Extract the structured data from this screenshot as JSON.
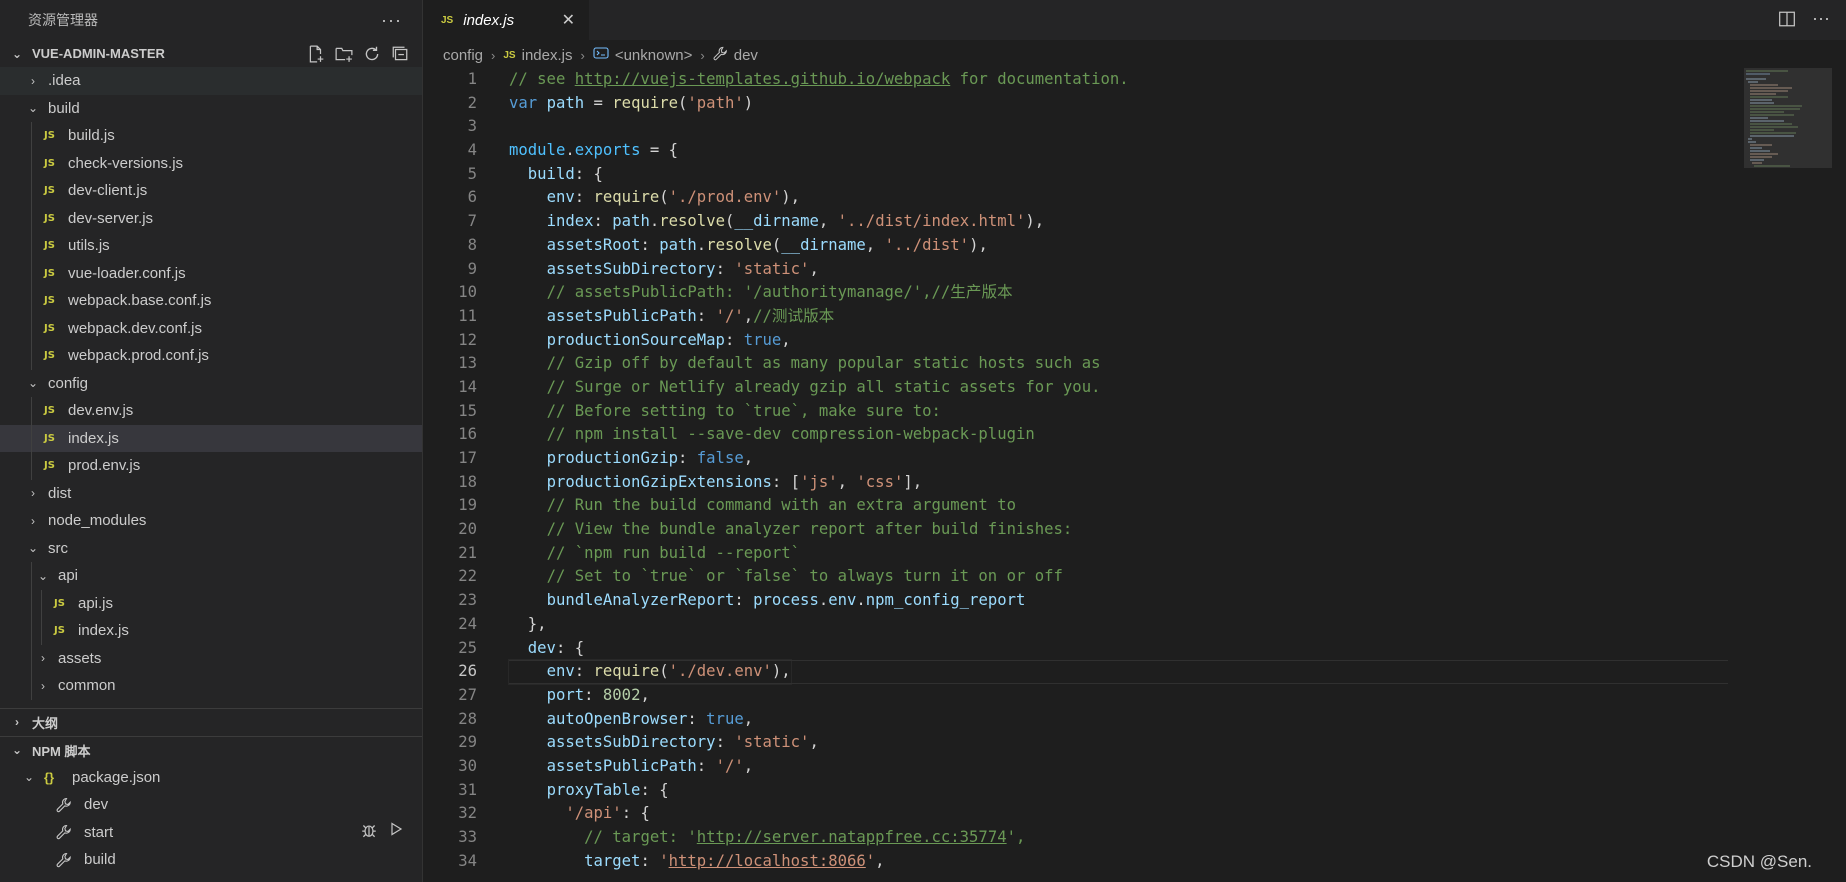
{
  "explorer": {
    "title": "资源管理器",
    "more": "···",
    "project": "VUE-ADMIN-MASTER",
    "tree": [
      {
        "label": ".idea",
        "type": "folder",
        "open": false,
        "depth": 0
      },
      {
        "label": "build",
        "type": "folder",
        "open": true,
        "depth": 0
      },
      {
        "label": "build.js",
        "type": "js",
        "depth": 1
      },
      {
        "label": "check-versions.js",
        "type": "js",
        "depth": 1
      },
      {
        "label": "dev-client.js",
        "type": "js",
        "depth": 1
      },
      {
        "label": "dev-server.js",
        "type": "js",
        "depth": 1
      },
      {
        "label": "utils.js",
        "type": "js",
        "depth": 1
      },
      {
        "label": "vue-loader.conf.js",
        "type": "js",
        "depth": 1
      },
      {
        "label": "webpack.base.conf.js",
        "type": "js",
        "depth": 1
      },
      {
        "label": "webpack.dev.conf.js",
        "type": "js",
        "depth": 1
      },
      {
        "label": "webpack.prod.conf.js",
        "type": "js",
        "depth": 1
      },
      {
        "label": "config",
        "type": "folder",
        "open": true,
        "depth": 0
      },
      {
        "label": "dev.env.js",
        "type": "js",
        "depth": 1
      },
      {
        "label": "index.js",
        "type": "js",
        "depth": 1,
        "selected": true
      },
      {
        "label": "prod.env.js",
        "type": "js",
        "depth": 1
      },
      {
        "label": "dist",
        "type": "folder",
        "open": false,
        "depth": 0
      },
      {
        "label": "node_modules",
        "type": "folder",
        "open": false,
        "depth": 0
      },
      {
        "label": "src",
        "type": "folder",
        "open": true,
        "depth": 0
      },
      {
        "label": "api",
        "type": "folder",
        "open": true,
        "depth": 1
      },
      {
        "label": "api.js",
        "type": "js",
        "depth": 2
      },
      {
        "label": "index.js",
        "type": "js",
        "depth": 2
      },
      {
        "label": "assets",
        "type": "folder",
        "open": false,
        "depth": 1
      },
      {
        "label": "common",
        "type": "folder",
        "open": false,
        "depth": 1
      }
    ],
    "outline_label": "大纲",
    "npm_label": "NPM 脚本",
    "npm": {
      "package": "package.json",
      "scripts": [
        "dev",
        "start",
        "build"
      ]
    }
  },
  "tab": {
    "label": "index.js",
    "close": "✕"
  },
  "breadcrumb": {
    "folder": "config",
    "file": "index.js",
    "symbol": "<unknown>",
    "member": "dev"
  },
  "watermark": "CSDN @Sen.",
  "colors": {
    "accent": "#007acc",
    "comment": "#6a9955",
    "string": "#ce9178",
    "keyword": "#569cd6",
    "property": "#9cdcfe",
    "function": "#dcdcaa",
    "js_icon": "#cbcb41"
  },
  "code": [
    {
      "n": "1",
      "tokens": [
        [
          "c",
          "// see "
        ],
        [
          "cu",
          "http://vuejs-templates.github.io/webpack"
        ],
        [
          "c",
          " for documentation."
        ]
      ]
    },
    {
      "n": "2",
      "tokens": [
        [
          "k",
          "var "
        ],
        [
          "p",
          "path"
        ],
        [
          "o",
          " = "
        ],
        [
          "f",
          "require"
        ],
        [
          "o",
          "("
        ],
        [
          "s",
          "'path'"
        ],
        [
          "o",
          ")"
        ]
      ]
    },
    {
      "n": "3",
      "tokens": []
    },
    {
      "n": "4",
      "tokens": [
        [
          "v",
          "module"
        ],
        [
          "o",
          "."
        ],
        [
          "v",
          "exports"
        ],
        [
          "o",
          " = {"
        ]
      ]
    },
    {
      "n": "5",
      "tokens": [
        [
          "o",
          "  "
        ],
        [
          "p",
          "build"
        ],
        [
          "o",
          ": {"
        ]
      ]
    },
    {
      "n": "6",
      "tokens": [
        [
          "o",
          "    "
        ],
        [
          "p",
          "env"
        ],
        [
          "o",
          ": "
        ],
        [
          "f",
          "require"
        ],
        [
          "o",
          "("
        ],
        [
          "s",
          "'./prod.env'"
        ],
        [
          "o",
          "),"
        ]
      ]
    },
    {
      "n": "7",
      "tokens": [
        [
          "o",
          "    "
        ],
        [
          "p",
          "index"
        ],
        [
          "o",
          ": "
        ],
        [
          "p",
          "path"
        ],
        [
          "o",
          "."
        ],
        [
          "f",
          "resolve"
        ],
        [
          "o",
          "("
        ],
        [
          "p",
          "__dirname"
        ],
        [
          "o",
          ", "
        ],
        [
          "s",
          "'../dist/index.html'"
        ],
        [
          "o",
          "),"
        ]
      ]
    },
    {
      "n": "8",
      "tokens": [
        [
          "o",
          "    "
        ],
        [
          "p",
          "assetsRoot"
        ],
        [
          "o",
          ": "
        ],
        [
          "p",
          "path"
        ],
        [
          "o",
          "."
        ],
        [
          "f",
          "resolve"
        ],
        [
          "o",
          "("
        ],
        [
          "p",
          "__dirname"
        ],
        [
          "o",
          ", "
        ],
        [
          "s",
          "'../dist'"
        ],
        [
          "o",
          "),"
        ]
      ]
    },
    {
      "n": "9",
      "tokens": [
        [
          "o",
          "    "
        ],
        [
          "p",
          "assetsSubDirectory"
        ],
        [
          "o",
          ": "
        ],
        [
          "s",
          "'static'"
        ],
        [
          "o",
          ","
        ]
      ]
    },
    {
      "n": "10",
      "tokens": [
        [
          "o",
          "    "
        ],
        [
          "c",
          "// assetsPublicPath: '/authoritymanage/',//生产版本"
        ]
      ]
    },
    {
      "n": "11",
      "tokens": [
        [
          "o",
          "    "
        ],
        [
          "p",
          "assetsPublicPath"
        ],
        [
          "o",
          ": "
        ],
        [
          "s",
          "'/'"
        ],
        [
          "o",
          ","
        ],
        [
          "c",
          "//测试版本"
        ]
      ]
    },
    {
      "n": "12",
      "tokens": [
        [
          "o",
          "    "
        ],
        [
          "p",
          "productionSourceMap"
        ],
        [
          "o",
          ": "
        ],
        [
          "k",
          "true"
        ],
        [
          "o",
          ","
        ]
      ]
    },
    {
      "n": "13",
      "tokens": [
        [
          "o",
          "    "
        ],
        [
          "c",
          "// Gzip off by default as many popular static hosts such as"
        ]
      ]
    },
    {
      "n": "14",
      "tokens": [
        [
          "o",
          "    "
        ],
        [
          "c",
          "// Surge or Netlify already gzip all static assets for you."
        ]
      ]
    },
    {
      "n": "15",
      "tokens": [
        [
          "o",
          "    "
        ],
        [
          "c",
          "// Before setting to `true`, make sure to:"
        ]
      ]
    },
    {
      "n": "16",
      "tokens": [
        [
          "o",
          "    "
        ],
        [
          "c",
          "// npm install --save-dev compression-webpack-plugin"
        ]
      ]
    },
    {
      "n": "17",
      "tokens": [
        [
          "o",
          "    "
        ],
        [
          "p",
          "productionGzip"
        ],
        [
          "o",
          ": "
        ],
        [
          "k",
          "false"
        ],
        [
          "o",
          ","
        ]
      ]
    },
    {
      "n": "18",
      "tokens": [
        [
          "o",
          "    "
        ],
        [
          "p",
          "productionGzipExtensions"
        ],
        [
          "o",
          ": ["
        ],
        [
          "s",
          "'js'"
        ],
        [
          "o",
          ", "
        ],
        [
          "s",
          "'css'"
        ],
        [
          "o",
          "],"
        ]
      ]
    },
    {
      "n": "19",
      "tokens": [
        [
          "o",
          "    "
        ],
        [
          "c",
          "// Run the build command with an extra argument to"
        ]
      ]
    },
    {
      "n": "20",
      "tokens": [
        [
          "o",
          "    "
        ],
        [
          "c",
          "// View the bundle analyzer report after build finishes:"
        ]
      ]
    },
    {
      "n": "21",
      "tokens": [
        [
          "o",
          "    "
        ],
        [
          "c",
          "// `npm run build --report`"
        ]
      ]
    },
    {
      "n": "22",
      "tokens": [
        [
          "o",
          "    "
        ],
        [
          "c",
          "// Set to `true` or `false` to always turn it on or off"
        ]
      ]
    },
    {
      "n": "23",
      "tokens": [
        [
          "o",
          "    "
        ],
        [
          "p",
          "bundleAnalyzerReport"
        ],
        [
          "o",
          ": "
        ],
        [
          "p",
          "process"
        ],
        [
          "o",
          "."
        ],
        [
          "p",
          "env"
        ],
        [
          "o",
          "."
        ],
        [
          "p",
          "npm_config_report"
        ]
      ]
    },
    {
      "n": "24",
      "tokens": [
        [
          "o",
          "  },"
        ]
      ]
    },
    {
      "n": "25",
      "tokens": [
        [
          "o",
          "  "
        ],
        [
          "p",
          "dev"
        ],
        [
          "o",
          ": {"
        ]
      ]
    },
    {
      "n": "26",
      "tokens": [
        [
          "o",
          "    "
        ],
        [
          "p",
          "env"
        ],
        [
          "o",
          ": "
        ],
        [
          "f",
          "require"
        ],
        [
          "o",
          "("
        ],
        [
          "s",
          "'./dev.env'"
        ],
        [
          "o",
          "),"
        ]
      ],
      "active": true
    },
    {
      "n": "27",
      "tokens": [
        [
          "o",
          "    "
        ],
        [
          "p",
          "port"
        ],
        [
          "o",
          ": "
        ],
        [
          "n",
          "8002"
        ],
        [
          "o",
          ","
        ]
      ]
    },
    {
      "n": "28",
      "tokens": [
        [
          "o",
          "    "
        ],
        [
          "p",
          "autoOpenBrowser"
        ],
        [
          "o",
          ": "
        ],
        [
          "k",
          "true"
        ],
        [
          "o",
          ","
        ]
      ]
    },
    {
      "n": "29",
      "tokens": [
        [
          "o",
          "    "
        ],
        [
          "p",
          "assetsSubDirectory"
        ],
        [
          "o",
          ": "
        ],
        [
          "s",
          "'static'"
        ],
        [
          "o",
          ","
        ]
      ]
    },
    {
      "n": "30",
      "tokens": [
        [
          "o",
          "    "
        ],
        [
          "p",
          "assetsPublicPath"
        ],
        [
          "o",
          ": "
        ],
        [
          "s",
          "'/'"
        ],
        [
          "o",
          ","
        ]
      ]
    },
    {
      "n": "31",
      "tokens": [
        [
          "o",
          "    "
        ],
        [
          "p",
          "proxyTable"
        ],
        [
          "o",
          ": {"
        ]
      ]
    },
    {
      "n": "32",
      "tokens": [
        [
          "o",
          "      "
        ],
        [
          "s",
          "'/api'"
        ],
        [
          "o",
          ": {"
        ]
      ]
    },
    {
      "n": "33",
      "tokens": [
        [
          "o",
          "        "
        ],
        [
          "c",
          "// target: '"
        ],
        [
          "cu",
          "http://server.natappfree.cc:35774"
        ],
        [
          "c",
          "',"
        ]
      ]
    },
    {
      "n": "34",
      "tokens": [
        [
          "o",
          "        "
        ],
        [
          "p",
          "target"
        ],
        [
          "o",
          ": "
        ],
        [
          "s",
          "'"
        ],
        [
          "su",
          "http://localhost:8066"
        ],
        [
          "s",
          "'"
        ],
        [
          "o",
          ","
        ]
      ]
    }
  ]
}
